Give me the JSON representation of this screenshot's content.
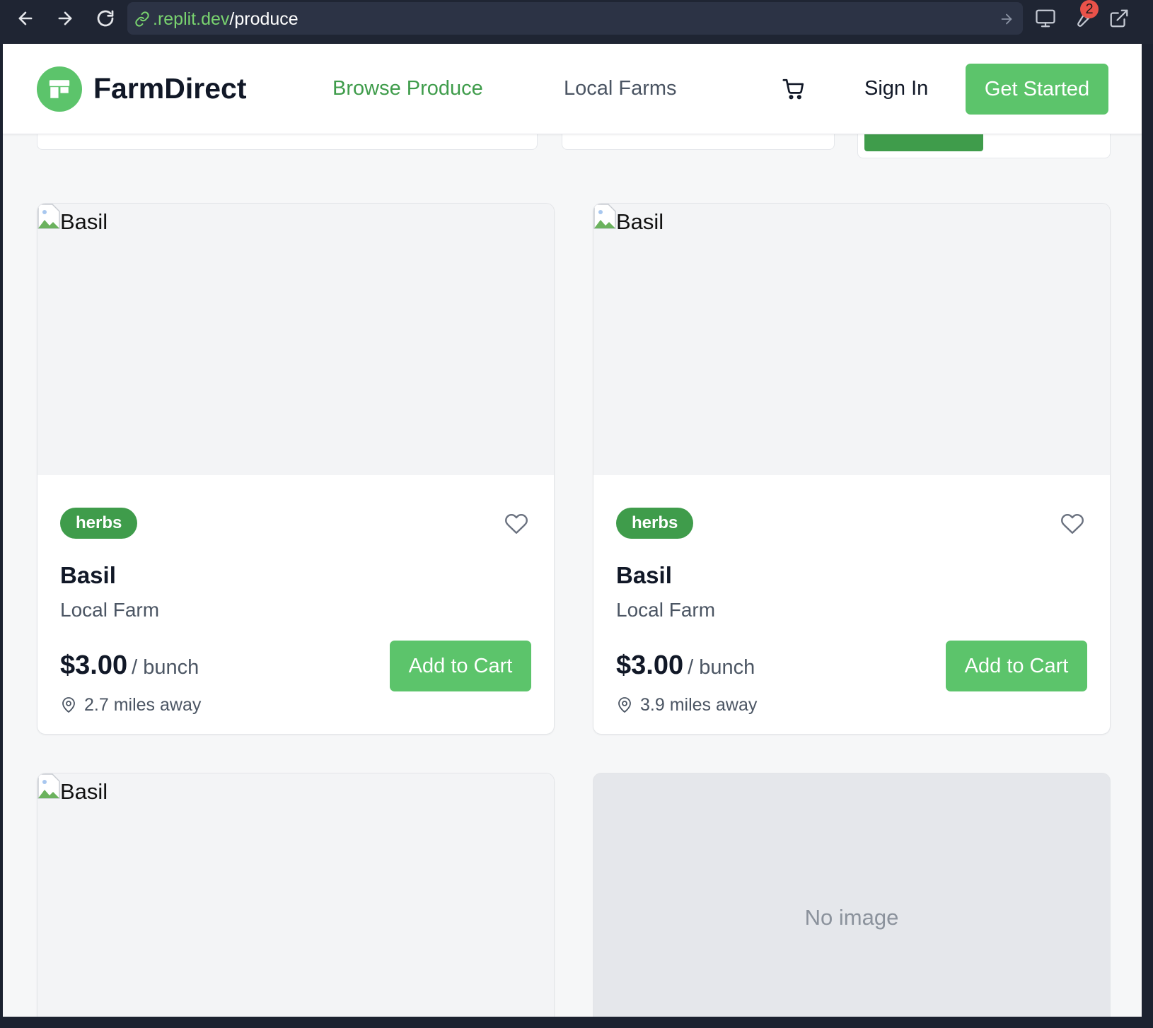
{
  "browser": {
    "url_host": ".replit.dev",
    "url_path": "/produce",
    "notification_count": "2"
  },
  "header": {
    "brand": "FarmDirect",
    "nav": [
      {
        "label": "Browse Produce",
        "active": true
      },
      {
        "label": "Local Farms",
        "active": false
      }
    ],
    "sign_in": "Sign In",
    "get_started": "Get Started"
  },
  "colors": {
    "brand_green": "#5cc46b",
    "accent_green": "#3f9c4b",
    "text_dark": "#111827",
    "text_muted": "#4b5563"
  },
  "products": [
    {
      "image_alt": "Basil",
      "category": "herbs",
      "name": "Basil",
      "farm": "Local Farm",
      "price": "$3.00",
      "unit": "/ bunch",
      "distance": "2.7 miles away",
      "add_label": "Add to Cart"
    },
    {
      "image_alt": "Basil",
      "category": "herbs",
      "name": "Basil",
      "farm": "Local Farm",
      "price": "$3.00",
      "unit": "/ bunch",
      "distance": "3.9 miles away",
      "add_label": "Add to Cart"
    },
    {
      "image_alt": "Basil"
    },
    {
      "placeholder": "No image"
    }
  ]
}
